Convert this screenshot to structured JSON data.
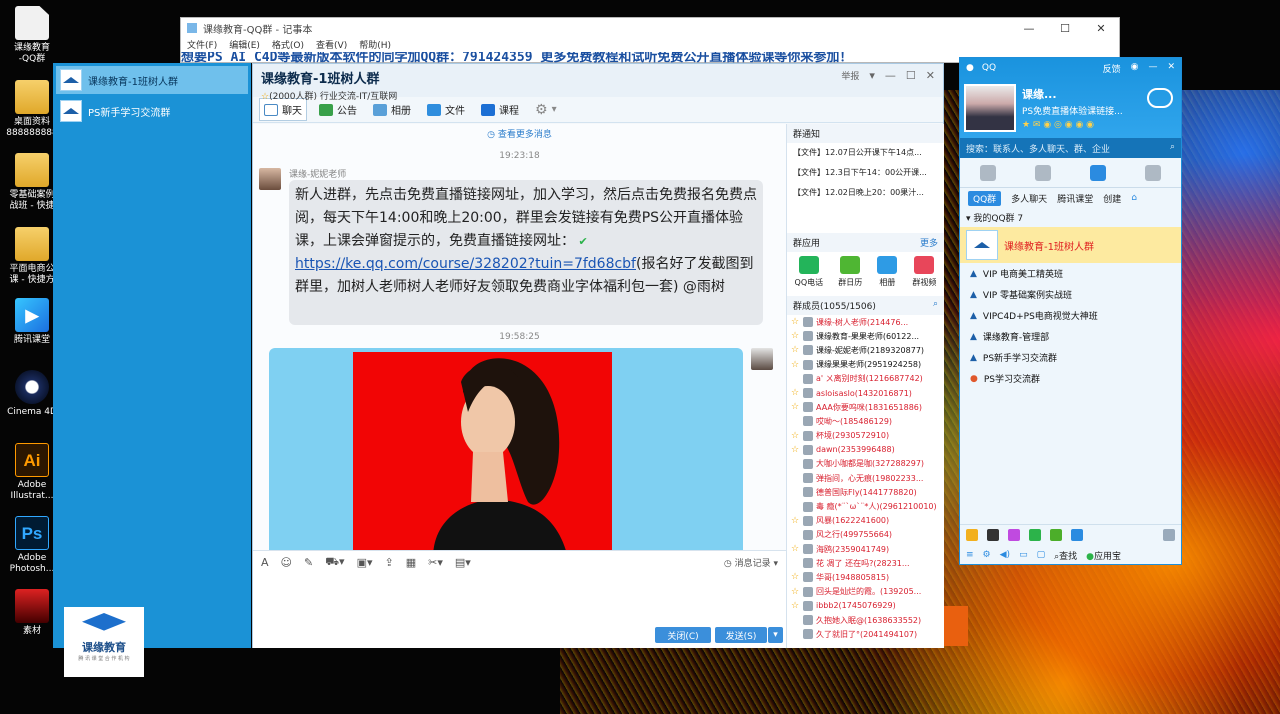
{
  "desktop": {
    "icons": [
      {
        "label": "课缘教育\n-QQ群"
      },
      {
        "label": "桌面资料\n888888888"
      },
      {
        "label": "零基础案例\n战班 - 快捷"
      },
      {
        "label": "平面电商公\n课 - 快捷方"
      },
      {
        "label": "腾讯课堂"
      },
      {
        "label": "Cinema 4D"
      },
      {
        "label": "Adobe\nIllustrat..."
      },
      {
        "label": "Adobe\nPhotosh..."
      },
      {
        "label": "素材"
      }
    ]
  },
  "notepad": {
    "title": "课缘教育-QQ群 - 记事本",
    "menus": [
      "文件(F)",
      "编辑(E)",
      "格式(O)",
      "查看(V)",
      "帮助(H)"
    ],
    "text": "想要PS AI C4D等最新版本软件的同学加QQ群：791424359 更多免费教程和试听免费公开直播体验课等你来参加！"
  },
  "group_panel": {
    "items": [
      {
        "label": "课缘教育-1班树人群",
        "selected": true
      },
      {
        "label": "PS新手学习交流群",
        "selected": false
      }
    ]
  },
  "chat": {
    "title": "课缘教育-1班树人群",
    "subtitle": "(2000人群) 行业交流-IT/互联网",
    "report": "举报",
    "tabs": [
      {
        "label": "聊天",
        "selected": true
      },
      {
        "label": "公告"
      },
      {
        "label": "相册"
      },
      {
        "label": "文件"
      },
      {
        "label": "课程"
      }
    ],
    "more_messages": "查看更多消息",
    "time1": "19:23:18",
    "sender1": "课缘-妮妮老师",
    "msg1_a": "新人进群，先点击免费直播链接网址，加入学习，然后点击免费报名免费点阅，每天下午14:00和晚上20:00，群里会发链接有免费PS公开直播体验课，上课会弹窗提示的，免费直播链接网址：",
    "msg1_link": "https://ke.qq.com/course/328202?tuin=7fd68cbf",
    "msg1_b": "(报名好了发截图到群里，加树人老师树人老师好友领取免费商业字体福利包一套) @雨树",
    "time2": "19:58:25",
    "history_label": "消息记录",
    "close_label": "关闭(C)",
    "send_label": "发送(S)",
    "notice_title": "群通知",
    "notices": [
      "【文件】12.07日公开课下午14点...",
      "【文件】12.3日下午14：00公开课...",
      "【文件】12.02日晚上20：00果汁..."
    ],
    "apps_title": "群应用",
    "apps_more": "更多",
    "apps": [
      {
        "label": "QQ电话",
        "color": "#23b45a"
      },
      {
        "label": "群日历",
        "color": "#4fb633"
      },
      {
        "label": "相册",
        "color": "#2e9be5"
      },
      {
        "label": "群视频",
        "color": "#e8465a"
      }
    ],
    "members_title": "群成员(1055/1506)",
    "members": [
      {
        "name": "课缘-树人老师(214476...",
        "color": "#d8202f",
        "star": true
      },
      {
        "name": "课缘教育-果果老师(60122...",
        "color": "#111111",
        "star": true
      },
      {
        "name": "课缘-妮妮老师(2189320877)",
        "color": "#111111",
        "star": true
      },
      {
        "name": "课缘果果老师(2951924258)",
        "color": "#111111",
        "star": true
      },
      {
        "name": "a' ㄨ离别时刻(1216687742)",
        "color": "#d8202f",
        "star": false
      },
      {
        "name": "asloisaslo(1432016871)",
        "color": "#d8202f",
        "star": true
      },
      {
        "name": "AAA你要呜咪(1831651886)",
        "color": "#d8202f",
        "star": true
      },
      {
        "name": "哎呦～(185486129)",
        "color": "#d8202f",
        "star": false
      },
      {
        "name": "杯境(2930572910)",
        "color": "#d8202f",
        "star": true
      },
      {
        "name": "dawn(2353996488)",
        "color": "#d8202f",
        "star": true
      },
      {
        "name": "大咖小咖都是咖(327288297)",
        "color": "#d8202f",
        "star": false
      },
      {
        "name": "弹指间，心无痕(19802233...",
        "color": "#d8202f",
        "star": false
      },
      {
        "name": "德普国际Fly(1441778820)",
        "color": "#d8202f",
        "star": false
      },
      {
        "name": "毒 瘾(*¨`ω`¨*人)(2961210010)",
        "color": "#d8202f",
        "star": false
      },
      {
        "name": "风暴(1622241600)",
        "color": "#d8202f",
        "star": true
      },
      {
        "name": "风之行(499755664)",
        "color": "#d8202f",
        "star": false
      },
      {
        "name": "海鸥(2359041749)",
        "color": "#d8202f",
        "star": true
      },
      {
        "name": "花  凋了  还在吗?(28231...",
        "color": "#d8202f",
        "star": false
      },
      {
        "name": "华哥(1948805815)",
        "color": "#d8202f",
        "star": true
      },
      {
        "name": "回头是灿烂的霞。(139205...",
        "color": "#d8202f",
        "star": true
      },
      {
        "name": "ibbb2(1745076929)",
        "color": "#d8202f",
        "star": true
      },
      {
        "name": "久抱她入眠@(1638633552)",
        "color": "#d8202f",
        "star": false
      },
      {
        "name": "久了就旧了°(2041494107)",
        "color": "#d8202f",
        "star": false
      }
    ]
  },
  "qq": {
    "title": "QQ",
    "feedback": "反馈",
    "nickname": "课缘...",
    "signature": "PS免费直播体验课链接...",
    "search_placeholder": "搜索：联系人、多人聊天、群、企业",
    "subtabs": [
      "QQ群",
      "多人聊天",
      "腾讯课堂",
      "创建"
    ],
    "my_groups": "我的QQ群 7",
    "groups": [
      {
        "label": "课缘教育-1班树人群",
        "selected": true
      },
      {
        "label": "VIP 电商美工精英班"
      },
      {
        "label": "VIP 零基础案例实战班"
      },
      {
        "label": "VIPC4D+PS电商视觉大神班"
      },
      {
        "label": "课缘教育-管理部"
      },
      {
        "label": "PS新手学习交流群"
      },
      {
        "label": "PS学习交流群"
      }
    ],
    "find_label": "查找",
    "appstore_label": "应用宝"
  },
  "logo": {
    "title": "课缘教育",
    "tagline": "腾 讯 课 堂 合 作 机 构"
  }
}
